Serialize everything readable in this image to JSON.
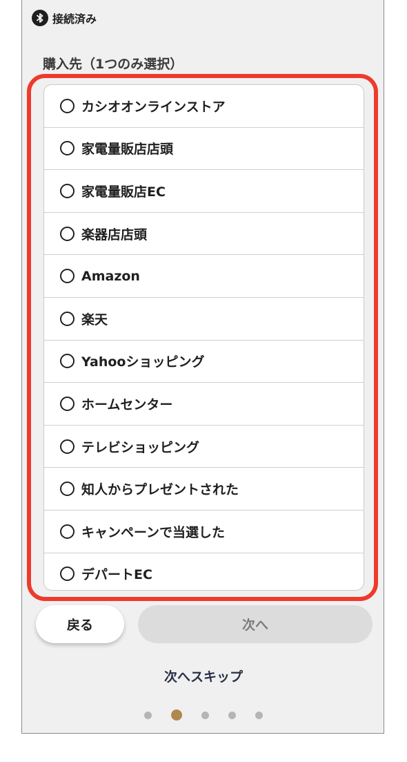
{
  "status": {
    "icon": "bluetooth-icon",
    "label": "接続済み"
  },
  "section": {
    "label": "購入先（1つのみ選択）"
  },
  "options": [
    "カシオオンラインストア",
    "家電量販店店頭",
    "家電量販店EC",
    "楽器店店頭",
    "Amazon",
    "楽天",
    "Yahooショッピング",
    "ホームセンター",
    "テレビショッピング",
    "知人からプレゼントされた",
    "キャンペーンで当選した",
    "デパートEC"
  ],
  "buttons": {
    "back": "戻る",
    "next": "次へ",
    "skip": "次へスキップ"
  },
  "pager": {
    "count": 5,
    "current": 2
  },
  "colors": {
    "highlight": "#ee3a2c",
    "active_dot": "#b0884f",
    "background": "#f0f0f0"
  }
}
